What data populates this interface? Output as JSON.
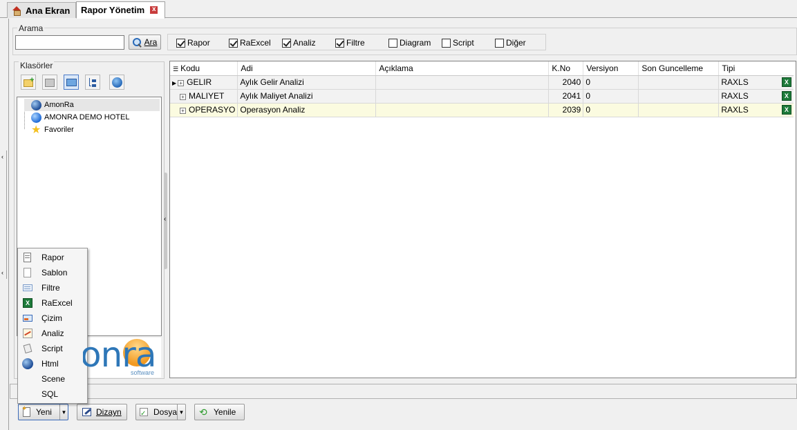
{
  "tabs": [
    {
      "label": "Ana Ekran",
      "icon": "home-icon"
    },
    {
      "label": "Rapor Yönetim",
      "icon": "close-icon"
    }
  ],
  "search": {
    "group_label": "Arama",
    "value": "",
    "button_label": "Ara"
  },
  "filters": [
    {
      "label": "Rapor",
      "checked": true
    },
    {
      "label": "RaExcel",
      "checked": true
    },
    {
      "label": "Analiz",
      "checked": true
    },
    {
      "label": "Filtre",
      "checked": true
    },
    {
      "label": "Diagram",
      "checked": false
    },
    {
      "label": "Script",
      "checked": false
    },
    {
      "label": "Diğer",
      "checked": false
    }
  ],
  "folders": {
    "group_label": "Klasörler",
    "toolbar_icons": [
      "new-folder-icon",
      "delete-folder-icon",
      "open-folder-icon",
      "tree-icon",
      "info-icon"
    ],
    "items": [
      {
        "label": "AmonRa",
        "icon": "globe-icon"
      },
      {
        "label": "AMONRA DEMO HOTEL",
        "icon": "globe-icon"
      },
      {
        "label": "Favoriler",
        "icon": "star-icon"
      }
    ],
    "logo_text": "onra",
    "logo_sub": "software"
  },
  "grid": {
    "columns": [
      "Kodu",
      "Adi",
      "Açıklama",
      "K.No",
      "Versiyon",
      "Son Guncelleme",
      "Tipi"
    ],
    "rows": [
      {
        "kodu": "GELIR",
        "adi": "Aylık Gelir Analizi",
        "aciklama": "",
        "kno": "2040",
        "versiyon": "0",
        "son": "",
        "tipi": "RAXLS"
      },
      {
        "kodu": "MALIYET",
        "adi": "Aylık Maliyet Analizi",
        "aciklama": "",
        "kno": "2041",
        "versiyon": "0",
        "son": "",
        "tipi": "RAXLS"
      },
      {
        "kodu": "OPERASYO",
        "adi": "Operasyon Analiz",
        "aciklama": "",
        "kno": "2039",
        "versiyon": "0",
        "son": "",
        "tipi": "RAXLS"
      }
    ]
  },
  "menu": {
    "items": [
      {
        "label": "Rapor",
        "icon": "report-icon"
      },
      {
        "label": "Sablon",
        "icon": "template-icon"
      },
      {
        "label": "Filtre",
        "icon": "filter-icon"
      },
      {
        "label": "RaExcel",
        "icon": "excel-icon"
      },
      {
        "label": "Çizim",
        "icon": "drawing-icon"
      },
      {
        "label": "Analiz",
        "icon": "chart-icon"
      },
      {
        "label": "Script",
        "icon": "script-icon"
      },
      {
        "label": "Html",
        "icon": "globe-icon"
      },
      {
        "label": "Scene",
        "icon": ""
      },
      {
        "label": "SQL",
        "icon": ""
      }
    ]
  },
  "bottom": {
    "yeni": "Yeni",
    "dizayn": "Dizayn",
    "dosya": "Dosya",
    "yenile": "Yenile"
  }
}
